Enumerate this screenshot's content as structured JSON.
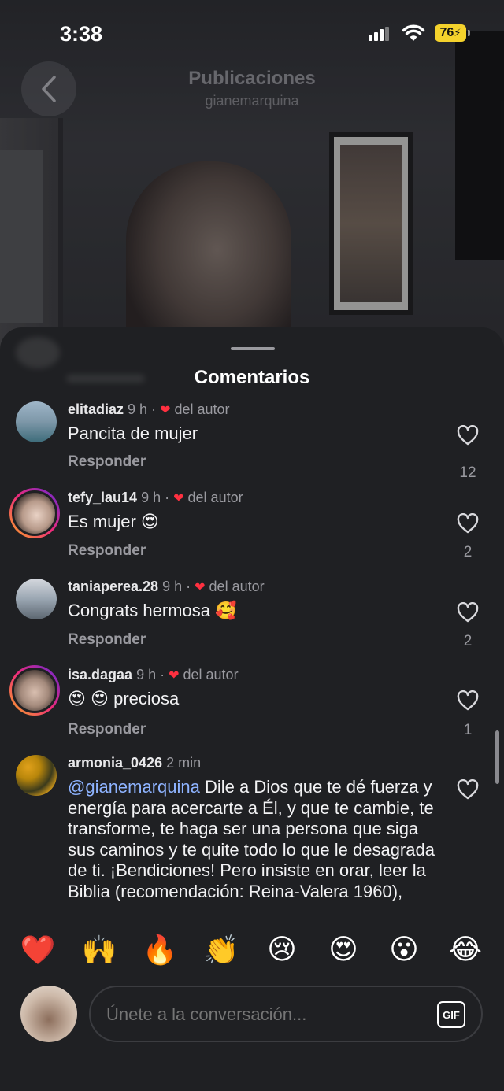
{
  "status_bar": {
    "time": "3:38",
    "battery": "76"
  },
  "header": {
    "title": "Publicaciones",
    "subtitle": "gianemarquina"
  },
  "sheet": {
    "title": "Comentarios"
  },
  "comments": [
    {
      "user": "elitadiaz",
      "time": "9 h",
      "author_label": "del autor",
      "text": "Pancita de mujer",
      "reply": "Responder",
      "likes": "12"
    },
    {
      "user": "tefy_lau14",
      "time": "9 h",
      "author_label": "del autor",
      "text": "Es mujer 😍",
      "reply": "Responder",
      "likes": "2"
    },
    {
      "user": "taniaperea.28",
      "time": "9 h",
      "author_label": "del autor",
      "text": "Congrats hermosa 🥰",
      "reply": "Responder",
      "likes": "2"
    },
    {
      "user": "isa.dagaa",
      "time": "9 h",
      "author_label": "del autor",
      "text": "😍 😍  preciosa",
      "reply": "Responder",
      "likes": "1"
    },
    {
      "user": "armonia_0426",
      "time": "2 min",
      "mention": "@gianemarquina",
      "text": " Dile a Dios que te dé fuerza y energía para acercarte a Él, y que te cambie, te transforme, te haga ser una persona que siga sus caminos y te quite todo lo que le desagrada de ti. ¡Bendiciones! Pero insiste en orar, leer la Biblia (recomendación: Reina-Valera 1960),"
    }
  ],
  "emoji_bar": [
    "❤️",
    "🙌",
    "🔥",
    "👏",
    "😢",
    "😍",
    "😮",
    "😂"
  ],
  "input": {
    "placeholder": "Únete a la conversación...",
    "gif_label": "GIF"
  },
  "colors": {
    "accent_heart": "#ff3040",
    "mention": "#8eb3ff",
    "sheet_bg": "#1f2023",
    "battery": "#f4d22c"
  }
}
